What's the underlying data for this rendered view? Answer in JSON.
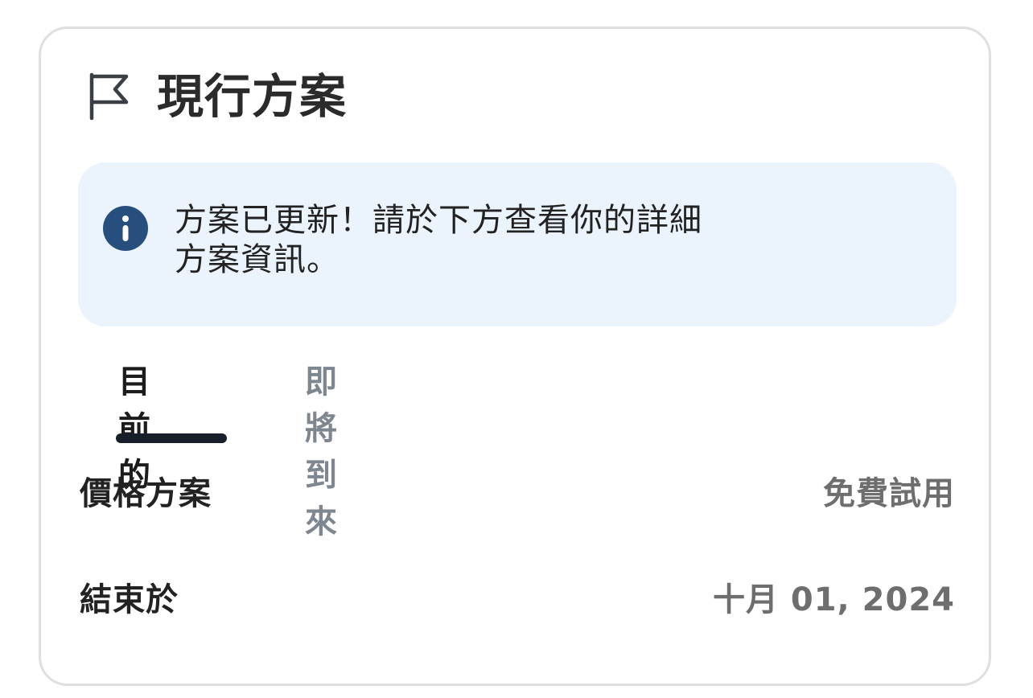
{
  "card": {
    "title": "現行方案",
    "title_icon": "flag-icon"
  },
  "notice": {
    "icon": "info-icon",
    "line1": "方案已更新！請於下方查看你的詳細",
    "line2": "方案資訊。",
    "background": "#ebf3fc",
    "icon_color": "#264f7e"
  },
  "tabs": [
    {
      "label": "目前的",
      "selected": true
    },
    {
      "label": "即將到來",
      "selected": false
    }
  ],
  "details": {
    "plan_label": "價格方案",
    "plan_value": "免費試用",
    "end_label": "結束於",
    "end_value": "十月 01, 2024"
  }
}
